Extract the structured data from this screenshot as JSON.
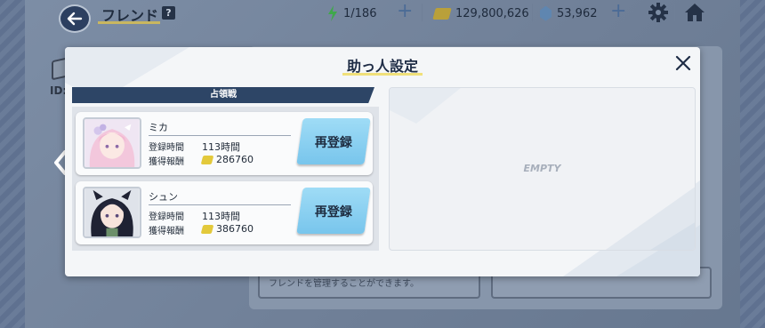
{
  "topbar": {
    "page_title": "フレンド",
    "help_label": "?",
    "energy": "1/186",
    "credits": "129,800,626",
    "gems": "53,962",
    "plus_label": "+"
  },
  "background": {
    "id_label": "ID:",
    "card_text": "フレンドを管理することができます。"
  },
  "modal": {
    "title": "助っ人設定",
    "close_label": "×",
    "section_header": "占領戦",
    "empty_label": "EMPTY",
    "helpers": [
      {
        "name": "ミカ",
        "time_label": "登録時間",
        "time_value": "113時間",
        "reward_label": "獲得報酬",
        "reward_value": "286760",
        "button_label": "再登録"
      },
      {
        "name": "シュン",
        "time_label": "登録時間",
        "time_value": "113時間",
        "reward_label": "獲得報酬",
        "reward_value": "386760",
        "button_label": "再登録"
      }
    ]
  },
  "colors": {
    "accent_yellow": "#f0e07a",
    "navy_header": "#2d4566",
    "button_blue": "#78c5ec"
  }
}
